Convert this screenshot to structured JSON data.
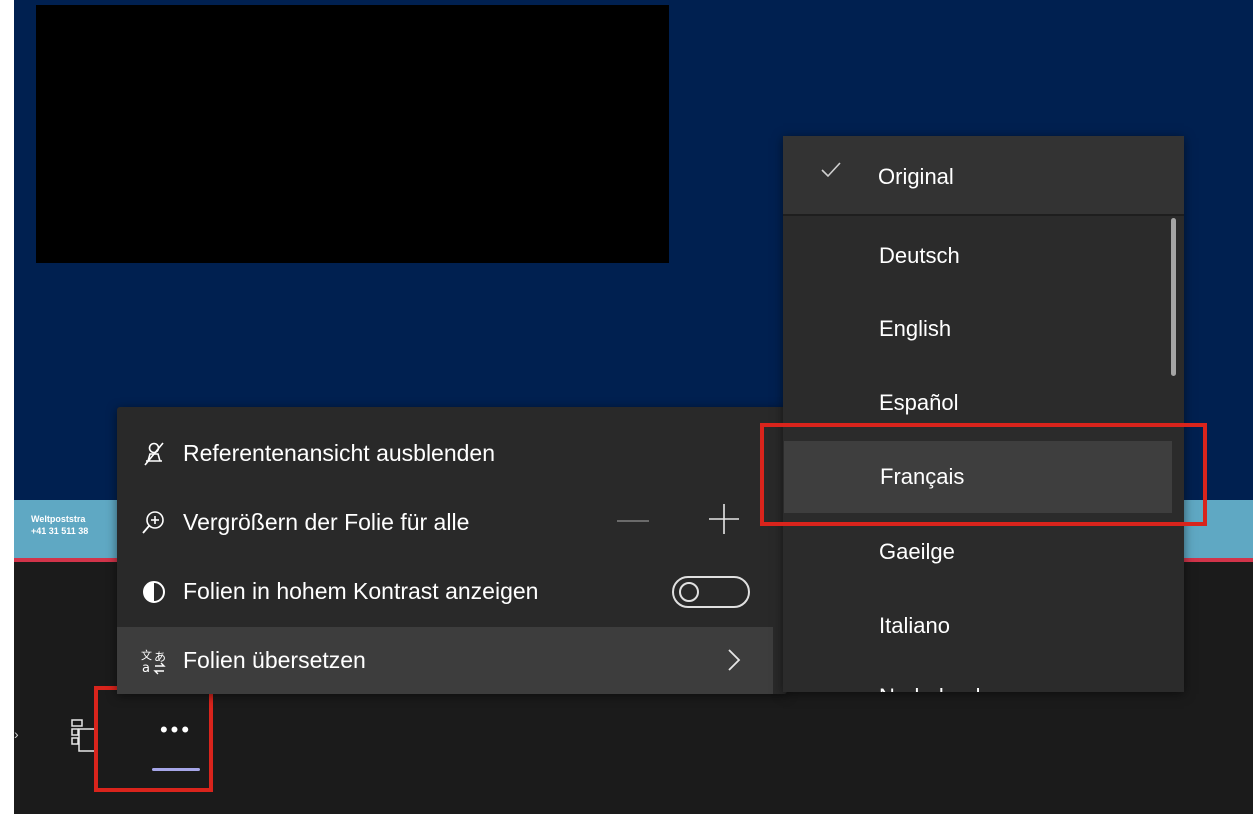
{
  "slide": {
    "footer_line1": "Weltpoststra",
    "footer_line2": "+41 31 511 38"
  },
  "toolbar": {
    "more_icon": "more-dots-icon",
    "more_label": "•••",
    "layout_icon": "layout-icon"
  },
  "menu": {
    "items": [
      {
        "label": "Referentenansicht ausblenden",
        "icon": "hide-presenter-icon"
      },
      {
        "label": "Vergrößern der Folie für alle",
        "icon": "zoom-in-icon"
      },
      {
        "label": "Folien in hohem Kontrast anzeigen",
        "icon": "contrast-icon",
        "toggle_on": false
      },
      {
        "label": "Folien übersetzen",
        "icon": "translate-icon",
        "active": true
      }
    ]
  },
  "languages": {
    "selected": "Original",
    "options": [
      "Deutsch",
      "English",
      "Español",
      "Français",
      "Gaeilge",
      "Italiano",
      "Nederlands"
    ],
    "hovered": "Français"
  },
  "colors": {
    "slide_background": "#002050",
    "menu_background": "#292929",
    "highlight_box": "#d9241c",
    "accent_underline": "#a6a6e8"
  }
}
